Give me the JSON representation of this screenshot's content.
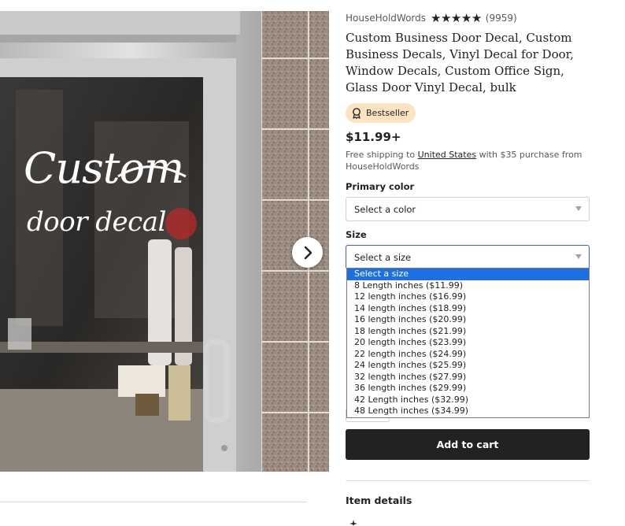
{
  "listing": {
    "shop_name": "HouseHoldWords",
    "stars": "★★★★★",
    "review_count": "(9959)",
    "title": "Custom Business Door Decal, Custom Business Decals, Vinyl Decal for Door, Window Decals, Custom Office Sign, Glass Door Vinyl Decal, bulk",
    "badge": "Bestseller",
    "price": "$11.99+",
    "shipping": {
      "prefix": "Free shipping to ",
      "country_link": "United States",
      "suffix": " with $35 purchase from HouseHoldWords"
    }
  },
  "image": {
    "decal_line1": "Custom",
    "decal_line2": "door decal"
  },
  "options": {
    "color": {
      "label": "Primary color",
      "placeholder": "Select a color"
    },
    "size": {
      "label": "Size",
      "placeholder": "Select a size",
      "items": [
        "Select a size",
        "8 Length inches ($11.99)",
        "12 length inches ($16.99)",
        "14 length inches ($18.99)",
        "16 length inches ($20.99)",
        "18 length inches ($21.99)",
        "20 length inches ($23.99)",
        "22 length inches ($24.99)",
        "24 length inches ($25.99)",
        "32 length inches ($27.99)",
        "36 length inches ($29.99)",
        "42 Length inches ($32.99)",
        "48 Length inches ($34.99)"
      ],
      "highlighted_index": 0
    }
  },
  "actions": {
    "add_to_cart": "Add to cart"
  },
  "sections": {
    "item_details": "Item details"
  },
  "colors": {
    "badge_bg": "#fde3c2",
    "cart_button": "#222222",
    "dropdown_highlight": "#1e6fe0",
    "focus_border": "#2d6cc0"
  },
  "icons": {
    "carousel": "chevron-right-icon",
    "badge": "award-ribbon-icon",
    "select": "caret-down-icon"
  }
}
